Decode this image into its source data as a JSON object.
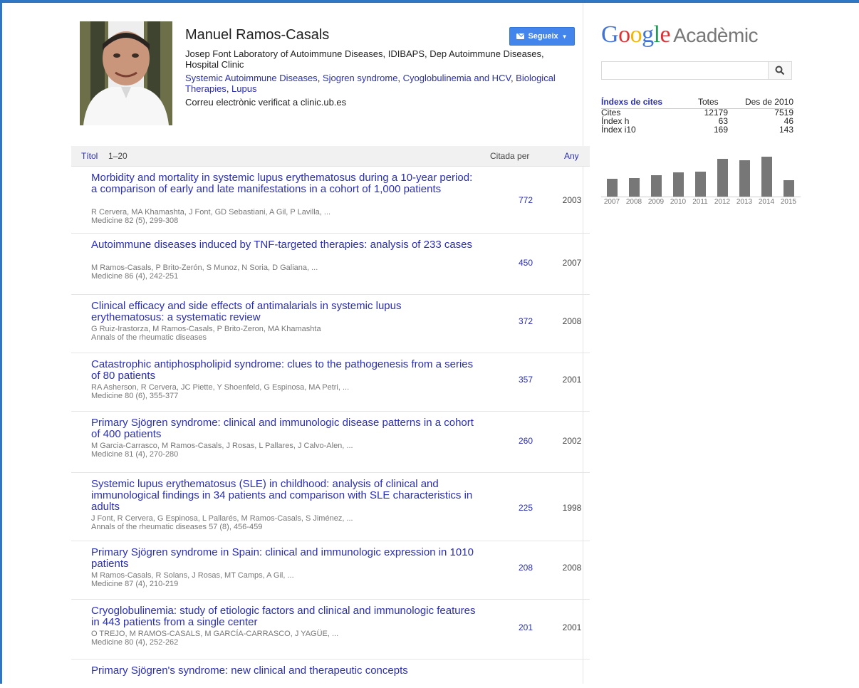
{
  "profile": {
    "name": "Manuel Ramos-Casals",
    "affiliation": "Josep Font Laboratory of Autoimmune Diseases, IDIBAPS, Dep Autoimmune Diseases, Hospital Clinic",
    "interests": [
      "Systemic Autoimmune Diseases",
      "Sjogren syndrome",
      "Cyoglobulinemia and HCV",
      "Biological Therapies",
      "Lupus"
    ],
    "email": "Correu electrònic verificat a clinic.ub.es",
    "follow_label": "Segueix"
  },
  "table": {
    "title_label": "Títol",
    "range": "1–20",
    "cited_label": "Citada per",
    "year_label": "Any"
  },
  "articles": [
    {
      "title": "Morbidity and mortality in systemic lupus erythematosus during a 10-year period: a comparison of early and late manifestations in a cohort of 1,000 patients",
      "authors": "R Cervera, MA Khamashta, J Font, GD Sebastiani, A Gil, P Lavilla, ...",
      "venue": "Medicine 82 (5), 299-308",
      "cited": "772",
      "year": "2003"
    },
    {
      "title": "Autoimmune diseases induced by TNF-targeted therapies: analysis of 233 cases",
      "authors": "M Ramos-Casals, P Brito-Zerón, S Munoz, N Soria, D Galiana, ...",
      "venue": "Medicine 86 (4), 242-251",
      "cited": "450",
      "year": "2007"
    },
    {
      "title": "Clinical efficacy and side effects of antimalarials in systemic lupus erythematosus: a systematic review",
      "authors": "G Ruiz-Irastorza, M Ramos-Casals, P Brito-Zeron, MA Khamashta",
      "venue": "Annals of the rheumatic diseases",
      "cited": "372",
      "year": "2008"
    },
    {
      "title": "Catastrophic antiphospholipid syndrome: clues to the pathogenesis from a series of 80 patients",
      "authors": "RA Asherson, R Cervera, JC Piette, Y Shoenfeld, G Espinosa, MA Petri, ...",
      "venue": "Medicine 80 (6), 355-377",
      "cited": "357",
      "year": "2001"
    },
    {
      "title": "Primary Sjögren syndrome: clinical and immunologic disease patterns in a cohort of 400 patients",
      "authors": "M Garcia-Carrasco, M Ramos-Casals, J Rosas, L Pallares, J Calvo-Alen, ...",
      "venue": "Medicine 81 (4), 270-280",
      "cited": "260",
      "year": "2002"
    },
    {
      "title": "Systemic lupus erythematosus (SLE) in childhood: analysis of clinical and immunological findings in 34 patients and comparison with SLE characteristics in adults",
      "authors": "J Font, R Cervera, G Espinosa, L Pallarés, M Ramos-Casals, S Jiménez, ...",
      "venue": "Annals of the rheumatic diseases 57 (8), 456-459",
      "cited": "225",
      "year": "1998"
    },
    {
      "title": "Primary Sjögren syndrome in Spain: clinical and immunologic expression in 1010 patients",
      "authors": "M Ramos-Casals, R Solans, J Rosas, MT Camps, A Gil, ...",
      "venue": "Medicine 87 (4), 210-219",
      "cited": "208",
      "year": "2008"
    },
    {
      "title": "Cryoglobulinemia: study of etiologic factors and clinical and immunologic features in 443 patients from a single center",
      "authors": "O TREJO, M RAMOS-CASALS, M GARCÍA-CARRASCO, J YAGÜE, ...",
      "venue": "Medicine 80 (4), 252-262",
      "cited": "201",
      "year": "2001"
    },
    {
      "title": "Primary Sjögren's syndrome: new clinical and therapeutic concepts",
      "authors": "",
      "venue": "",
      "cited": "",
      "year": ""
    }
  ],
  "sidebar": {
    "logo_brand": "Google",
    "logo_suffix": "Acadèmic",
    "search_value": "",
    "metrics": {
      "header": "Índexs de cites",
      "col_total": "Totes",
      "col_since": "Des de 2010",
      "rows": [
        {
          "label": "Cites",
          "total": "12179",
          "since": "7519"
        },
        {
          "label": "Índex h",
          "total": "63",
          "since": "46"
        },
        {
          "label": "Índex i10",
          "total": "169",
          "since": "143"
        }
      ]
    },
    "histogram": {
      "years": [
        "2007",
        "2008",
        "2009",
        "2010",
        "2011",
        "2012",
        "2013",
        "2014",
        "2015"
      ],
      "values": [
        24,
        25,
        28,
        32,
        33,
        50,
        48,
        53,
        22
      ]
    }
  },
  "colors": {
    "link": "#2a2fb4",
    "accent": "#4485ec",
    "bar": "#777777"
  }
}
